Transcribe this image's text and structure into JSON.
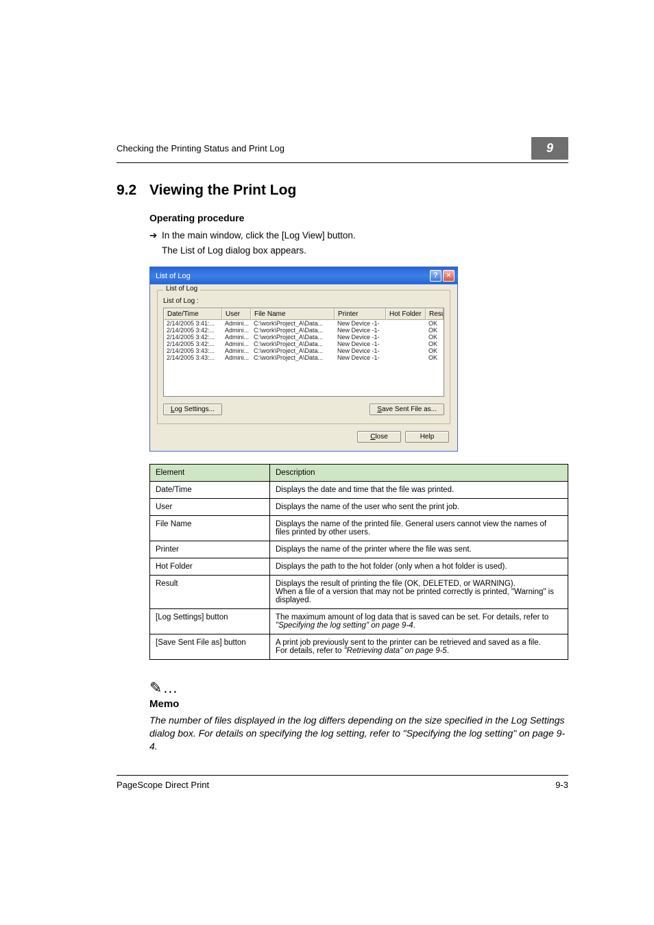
{
  "header": {
    "runningTitle": "Checking the Printing Status and Print Log",
    "chapterBadge": "9"
  },
  "section": {
    "number": "9.2",
    "title": "Viewing the Print Log"
  },
  "subheading": "Operating procedure",
  "step": {
    "arrow": "➔",
    "text": "In the main window, click the [Log View] button.",
    "follow": "The List of Log dialog box appears."
  },
  "dialog": {
    "title": "List of Log",
    "helpBtn": "?",
    "closeBtn": "×",
    "groupLabel": "List of Log",
    "innerLabel": "List of Log :",
    "columns": {
      "dateTime": "Date/Time",
      "user": "User",
      "fileName": "File Name",
      "printer": "Printer",
      "hotFolder": "Hot Folder",
      "result": "Result"
    },
    "rows": [
      {
        "dateTime": "2/14/2005 3:41:...",
        "user": "Admini...",
        "fileName": "C:\\work\\Project_A\\Data...",
        "printer": "New Device -1-",
        "hotFolder": "",
        "result": "OK"
      },
      {
        "dateTime": "2/14/2005 3:42:...",
        "user": "Admini...",
        "fileName": "C:\\work\\Project_A\\Data...",
        "printer": "New Device -1-",
        "hotFolder": "",
        "result": "OK"
      },
      {
        "dateTime": "2/14/2005 3:42:...",
        "user": "Admini...",
        "fileName": "C:\\work\\Project_A\\Data...",
        "printer": "New Device -1-",
        "hotFolder": "",
        "result": "OK"
      },
      {
        "dateTime": "2/14/2005 3:42:...",
        "user": "Admini...",
        "fileName": "C:\\work\\Project_A\\Data...",
        "printer": "New Device -1-",
        "hotFolder": "",
        "result": "OK"
      },
      {
        "dateTime": "2/14/2005 3:43:...",
        "user": "Admini...",
        "fileName": "C:\\work\\Project_A\\Data...",
        "printer": "New Device -1-",
        "hotFolder": "",
        "result": "OK"
      },
      {
        "dateTime": "2/14/2005 3:43:...",
        "user": "Admini...",
        "fileName": "C:\\work\\Project_A\\Data...",
        "printer": "New Device -1-",
        "hotFolder": "",
        "result": "OK"
      }
    ],
    "logSettingsBtn": "Log Settings...",
    "saveSentBtn": "Save Sent File as...",
    "closeBtnLabel": "Close",
    "helpBtnLabel": "Help"
  },
  "descTable": {
    "head": {
      "element": "Element",
      "description": "Description"
    },
    "rows": [
      {
        "element": "Date/Time",
        "description": "Displays the date and time that the file was printed."
      },
      {
        "element": "User",
        "description": "Displays the name of the user who sent the print job."
      },
      {
        "element": "File Name",
        "description": "Displays the name of the printed file. General users cannot view the names of files printed by other users."
      },
      {
        "element": "Printer",
        "description": "Displays the name of the printer where the file was sent."
      },
      {
        "element": "Hot Folder",
        "description": "Displays the path to the hot folder (only when a hot folder is used)."
      },
      {
        "element": "Result",
        "description": "Displays the result of printing the file (OK, DELETED, or WARNING).\nWhen a file of a version that may not be printed correctly is printed, \"Warning\" is displayed."
      },
      {
        "element": "[Log Settings] button",
        "descriptionPrefix": "The maximum amount of log data that is saved can be set. For details, refer to ",
        "descriptionItalic": "\"Specifying the log setting\" on page 9-4",
        "descriptionSuffix": "."
      },
      {
        "element": "[Save Sent File as] button",
        "descriptionPrefix": "A print job previously sent to the printer can be retrieved and saved as a file.\nFor details, refer to ",
        "descriptionItalic": "\"Retrieving data\" on page 9-5",
        "descriptionSuffix": "."
      }
    ]
  },
  "memo": {
    "icon": "✎…",
    "label": "Memo",
    "text": "The number of files displayed in the log differs depending on the size specified in the Log Settings dialog box. For details on specifying the log setting, refer to \"Specifying the log setting\" on page 9-4."
  },
  "footer": {
    "left": "PageScope Direct Print",
    "right": "9-3"
  }
}
